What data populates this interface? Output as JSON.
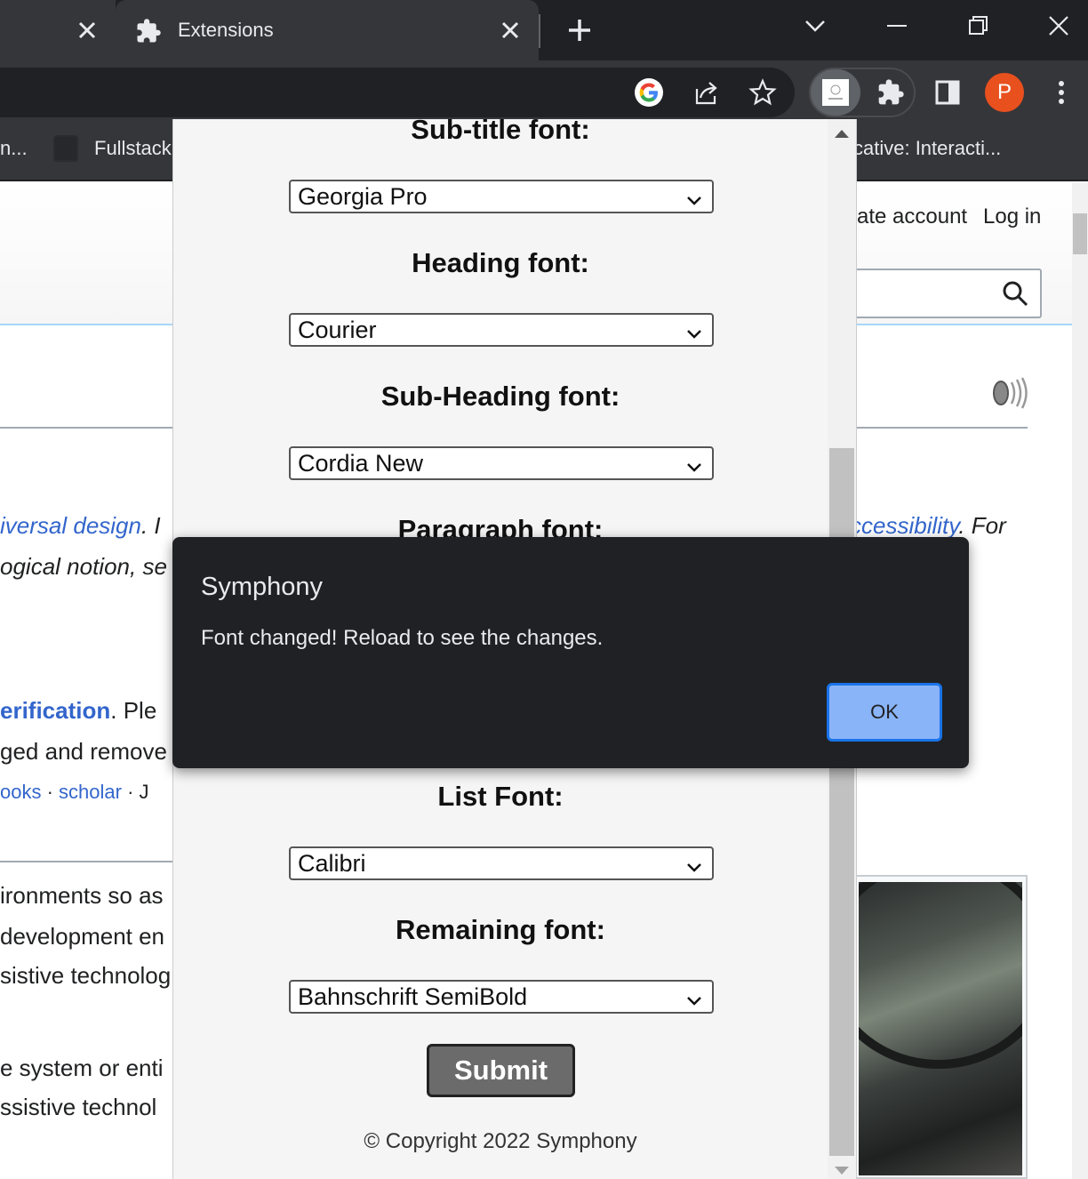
{
  "browser": {
    "tabs": [
      {
        "label": ""
      },
      {
        "label": "Extensions"
      }
    ],
    "bookmarks": [
      "n...",
      "Fullstack",
      "cative: Interacti..."
    ],
    "profile_initial": "P"
  },
  "page": {
    "header_links": [
      "ate account",
      "Log in"
    ],
    "text_lines": {
      "l1a": "iversal design",
      "l1b": ". I",
      "l1c": "ccessibility",
      "l1d": ". For",
      "l2": "ogical notion, se",
      "l3a": "erification",
      "l3b": ". Ple",
      "l4": "ged and remove",
      "l5a": "ooks",
      "l5b": " · ",
      "l5c": "scholar",
      "l5d": " · J",
      "l6": "ironments so as",
      "l7": "development en",
      "l8": "sistive technolog",
      "l9": "e system or enti",
      "l10": "ssistive technol"
    }
  },
  "popup": {
    "fields": [
      {
        "label": "Sub-title font:",
        "value": "Georgia Pro"
      },
      {
        "label": "Heading font:",
        "value": "Courier"
      },
      {
        "label": "Sub-Heading font:",
        "value": "Cordia New"
      },
      {
        "label": "Paragraph font:",
        "value": ""
      },
      {
        "label": "List Font:",
        "value": "Calibri"
      },
      {
        "label": "Remaining font:",
        "value": "Bahnschrift SemiBold"
      }
    ],
    "submit_label": "Submit",
    "copyright": "© Copyright 2022 Symphony"
  },
  "dialog": {
    "title": "Symphony",
    "message": "Font changed! Reload to see the changes.",
    "ok_label": "OK"
  },
  "colors": {
    "chrome_dark": "#202124",
    "chrome_tab": "#35363a",
    "link_blue": "#3366cc",
    "ok_button": "#8ab4f8",
    "avatar": "#e8501e"
  }
}
